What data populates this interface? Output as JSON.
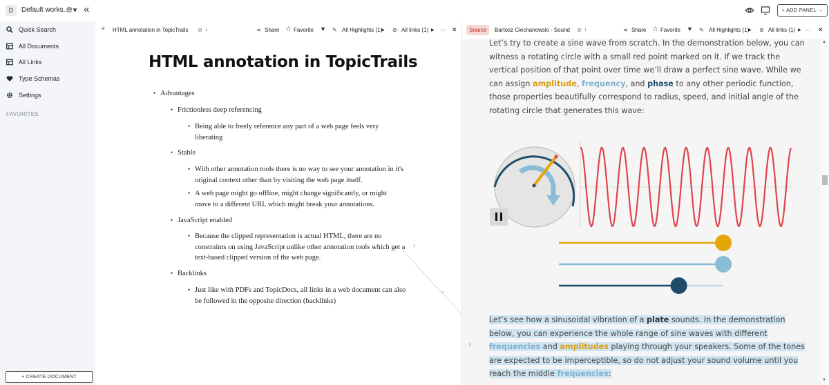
{
  "workspace": {
    "badge": "D",
    "name": "Default works..."
  },
  "topbar": {
    "add_panel": "+ ADD PANEL →"
  },
  "sidebar": {
    "items": [
      {
        "label": "Quick Search",
        "icon": "search-icon"
      },
      {
        "label": "All Documents",
        "icon": "table-icon"
      },
      {
        "label": "All Links",
        "icon": "table-icon"
      },
      {
        "label": "Type Schemas",
        "icon": "heart-icon"
      },
      {
        "label": "Settings",
        "icon": "gear-icon"
      }
    ],
    "favorites_label": "FAVORITES",
    "create_document": "+ CREATE DOCUMENT"
  },
  "left_panel": {
    "plus": "+",
    "title": "HTML annotation in TopicTrails",
    "link_count": "1",
    "share": "Share",
    "favorite": "Favorite",
    "highlights": "All Highlights (1)",
    "links": "All links (1)",
    "more": "···",
    "close": "✕"
  },
  "right_panel": {
    "badge": "Source",
    "title": "Bartosz Ciechanowski - Sound",
    "link_count": "1",
    "share": "Share",
    "favorite": "Favorite",
    "highlights": "All Highlights (1)",
    "links": "All links (1)",
    "more": "···",
    "close": "✕"
  },
  "document": {
    "title": "HTML annotation in TopicTrails",
    "bullets": [
      {
        "level": 1,
        "text": "Advantages"
      },
      {
        "level": 2,
        "text": "Frictionless deep referencing"
      },
      {
        "level": 3,
        "text": "Being able to freely reference any part of a web page feels very liberating"
      },
      {
        "level": 2,
        "text": "Stable"
      },
      {
        "level": 3,
        "text": "With other annotation tools there is no way to see your annotation in it's original context other than by visiting the web page itself."
      },
      {
        "level": 3,
        "text": "A web page might go offline, might change significantly, or might move to a different URL which might break your annotations."
      },
      {
        "level": 2,
        "text": "JavaScript enabled"
      },
      {
        "level": 3,
        "text": "Because the clipped representation is actual HTML, there are no constraints on using JavaScript unlike other annotation tools which get a text-based clipped version of the web page."
      },
      {
        "level": 2,
        "text": "Backlinks"
      },
      {
        "level": 3,
        "text": "Just like with PDFs and TopicDocs, all links in a web document can also be followed in the opposite direction (backlinks)"
      }
    ],
    "annotation_marker": "1"
  },
  "source": {
    "p1": {
      "a": "Let’s try to create a sine wave from scratch. In the demonstration below, you can witness a rotating circle with a small red point marked on it. If we track the vertical position of that point over time we’ll draw a perfect sine wave. While we can assign ",
      "amp": "amplitude",
      "sep1": ", ",
      "freq": "frequency",
      "sep2": ", and ",
      "phase": "phase",
      "b": " to any other periodic function, those properties beautifully correspond to radius, speed, and initial angle of the rotating circle that generates this wave:"
    },
    "p2": {
      "a": "Let’s see how a sinusoidal vibration of a ",
      "plate": "plate",
      "b": " sounds. In the demonstration below, you can experience the whole range of sine waves with different ",
      "freq": "frequencies",
      "c": " and ",
      "amp": "amplitudes",
      "d": " playing through your speakers. Some of the tones are expected to be imperceptible, so do not adjust your sound volume until you reach the middle ",
      "freq2": "frequencies",
      "e": ":"
    },
    "line_number": "1",
    "sliders": {
      "amplitude": 0.96,
      "frequency": 0.96,
      "phase": 0.7
    },
    "colors": {
      "amplitude": "#e5a60b",
      "frequency": "#8bbcd6",
      "phase": "#1f4c6b",
      "wave": "#e0434b"
    }
  }
}
